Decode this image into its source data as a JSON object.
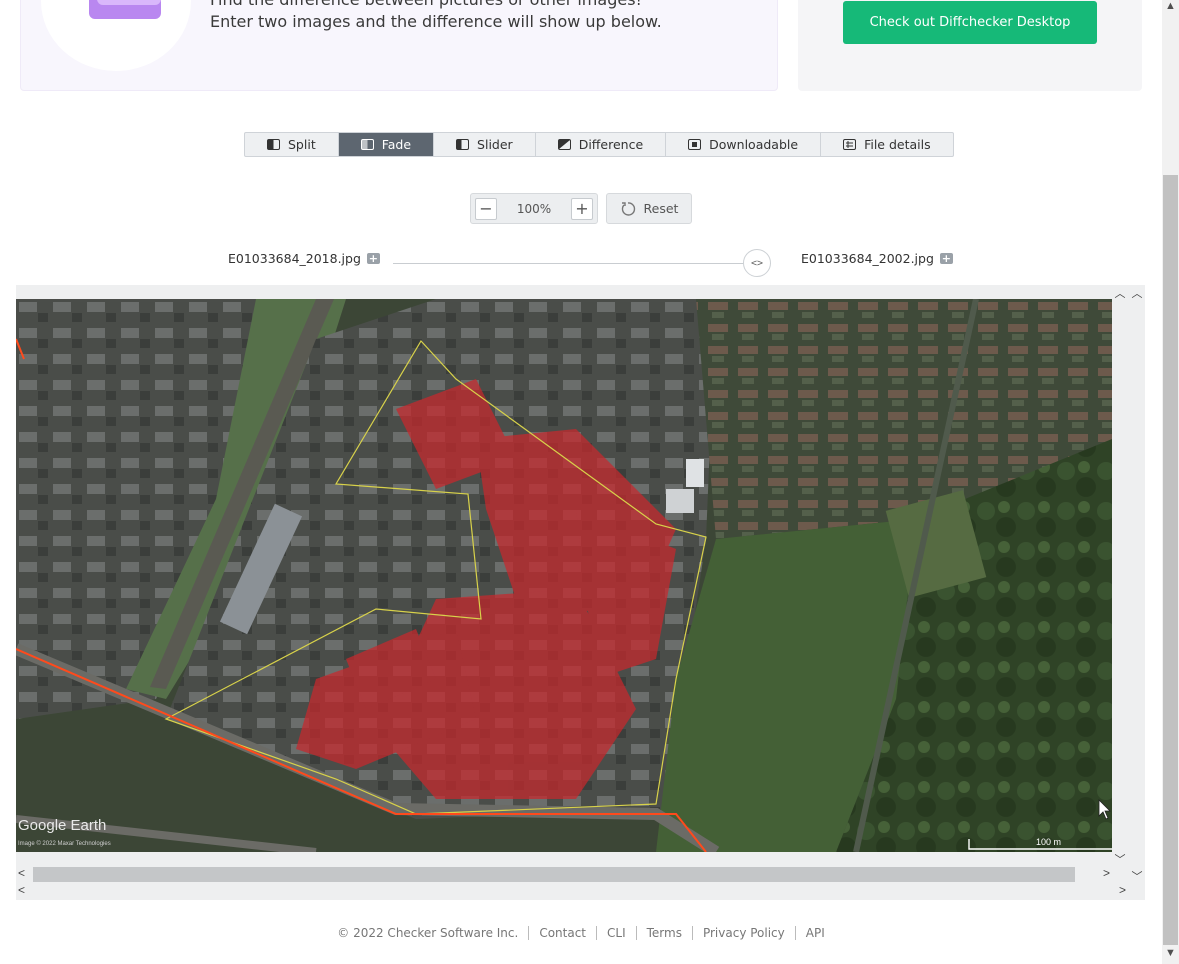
{
  "hero": {
    "line1": "Find the difference between pictures or other images!",
    "line2": "Enter two images and the difference will show up below."
  },
  "promo": {
    "button_label": "Check out Diffchecker Desktop"
  },
  "tabs": [
    {
      "label": "Split",
      "icon": "split-icon",
      "active": false
    },
    {
      "label": "Fade",
      "icon": "fade-icon",
      "active": true
    },
    {
      "label": "Slider",
      "icon": "slider-icon",
      "active": false
    },
    {
      "label": "Difference",
      "icon": "difference-icon",
      "active": false
    },
    {
      "label": "Downloadable",
      "icon": "downloadable-icon",
      "active": false
    },
    {
      "label": "File details",
      "icon": "file-details-icon",
      "active": false
    }
  ],
  "zoom": {
    "value": "100%",
    "minus": "−",
    "plus": "+",
    "reset_label": "Reset"
  },
  "files": {
    "left": "E01033684_2018.jpg",
    "right": "E01033684_2002.jpg",
    "fade_slider": 0.96
  },
  "map": {
    "watermark": "Google Earth",
    "credit": "Image © 2022 Maxar Technologies",
    "scale": "100 m"
  },
  "footer": {
    "copyright": "© 2022 Checker Software Inc.",
    "links": [
      "Contact",
      "CLI",
      "Terms",
      "Privacy Policy",
      "API"
    ]
  },
  "colors": {
    "accent_green": "#16b978",
    "active_tab": "#5d6670",
    "overlay_red": "#c8282d",
    "boundary_yellow": "#d8d24a",
    "boundary_orange": "#ff4a1c"
  }
}
